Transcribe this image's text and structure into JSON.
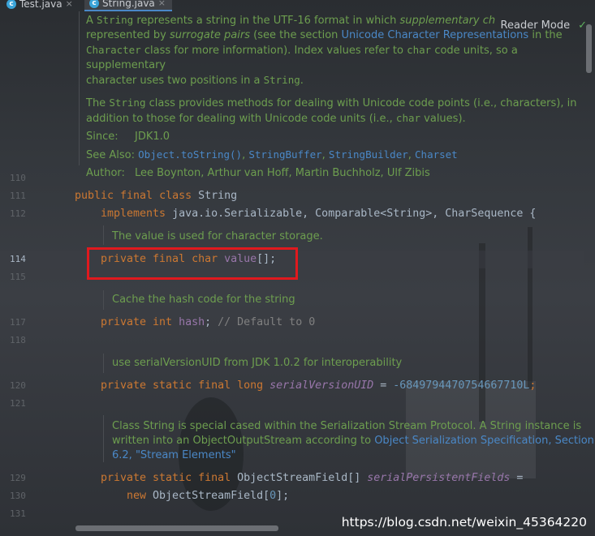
{
  "tabs": [
    {
      "label": "Test.java",
      "active": false
    },
    {
      "label": "String.java",
      "active": true
    }
  ],
  "reader_mode": "Reader Mode",
  "doc1": {
    "p1_parts": [
      "A ",
      "String",
      " represents a string in the UTF-16 format in which ",
      "supplementary ch"
    ],
    "p1_line2_parts": [
      "represented by ",
      "surrogate pairs",
      " (see the section ",
      "Unicode Character Representations",
      " in the"
    ],
    "p1_line3_parts": [
      "Character",
      " class for more information). Index values refer to ",
      "char",
      " code units, so a supplementary"
    ],
    "p1_line4_parts": [
      "character uses two positions in a ",
      "String",
      "."
    ],
    "p2_line1_parts": [
      "The ",
      "String",
      " class provides methods for dealing with Unicode code points (i.e., characters), in"
    ],
    "p2_line2_parts": [
      "addition to those for dealing with Unicode code units (i.e., ",
      "char",
      " values)."
    ],
    "since_label": "Since:",
    "since_value": "JDK1.0",
    "see_label": "See Also:",
    "see_links": [
      "Object.toString()",
      "StringBuffer",
      "StringBuilder",
      "Charset"
    ],
    "author_label": "Author:",
    "author_value": "Lee Boynton, Arthur van Hoff, Martin Buchholz, Ulf Zibis"
  },
  "line_numbers": [
    "110",
    "111",
    "112",
    "114",
    "115",
    "117",
    "118",
    "120",
    "121",
    "129",
    "130",
    "131"
  ],
  "current_line": "114",
  "code": {
    "l111": {
      "kw": "public final class ",
      "name": "String"
    },
    "l112": {
      "kw": "implements ",
      "rest": "java.io.Serializable, Comparable<String>, CharSequence {"
    },
    "doc_value": "The value is used for character storage.",
    "l114": {
      "kw": "private final char ",
      "field": "value",
      "rest": "[];"
    },
    "doc_hash": "Cache the hash code for the string",
    "l117": {
      "kw": "private int ",
      "field": "hash",
      "rest": "; ",
      "comment": "// Default to 0"
    },
    "doc_serial": "use serialVersionUID from JDK 1.0.2 for interoperability",
    "l120": {
      "kw": "private static final long ",
      "field": "serialVersionUID",
      "rest": " = ",
      "num": "-6849794470754667710L",
      ";": ";"
    },
    "doc_class": [
      "Class String is special cased within the Serialization Stream Protocol. A String instance is",
      "written into an ObjectOutputStream according to ",
      "Object Serialization Specification, Section",
      "6.2, \"Stream Elements\""
    ],
    "l129": {
      "kw": "private static final ",
      "type": "ObjectStreamField[] ",
      "field": "serialPersistentFields",
      "rest": " ="
    },
    "l130": {
      "kw": "new ",
      "rest": "ObjectStreamField[",
      "num": "0",
      "end": "];"
    }
  },
  "watermark": "https://blog.csdn.net/weixin_45364220"
}
